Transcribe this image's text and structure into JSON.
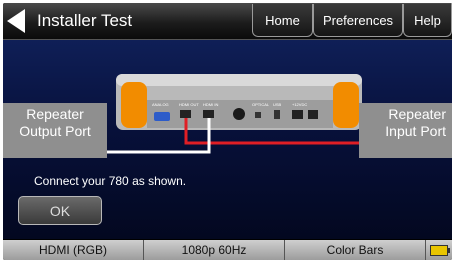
{
  "header": {
    "title": "Installer Test",
    "nav": [
      {
        "label": "Home"
      },
      {
        "label": "Preferences"
      },
      {
        "label": "Help"
      }
    ]
  },
  "diagram": {
    "left_port": {
      "line1": "Repeater",
      "line2": "Output Port"
    },
    "right_port": {
      "line1": "Repeater",
      "line2": "Input Port"
    },
    "device_labels": {
      "analog": "ANALOG",
      "hdmi_out": "HDMI OUT",
      "hdmi_in": "HDMI IN",
      "optical": "OPTICAL",
      "usb": "USB",
      "dc": "+12VDC"
    },
    "colors": {
      "hdmi_out_cable": "#e01e25",
      "hdmi_in_cable": "#ffffff",
      "device_accent": "#f28c00"
    }
  },
  "instruction": "Connect your 780 as shown.",
  "ok_label": "OK",
  "status": {
    "segments": [
      {
        "label": "HDMI (RGB)"
      },
      {
        "label": "1080p 60Hz"
      },
      {
        "label": "Color Bars"
      }
    ],
    "battery_icon": "battery-icon"
  }
}
